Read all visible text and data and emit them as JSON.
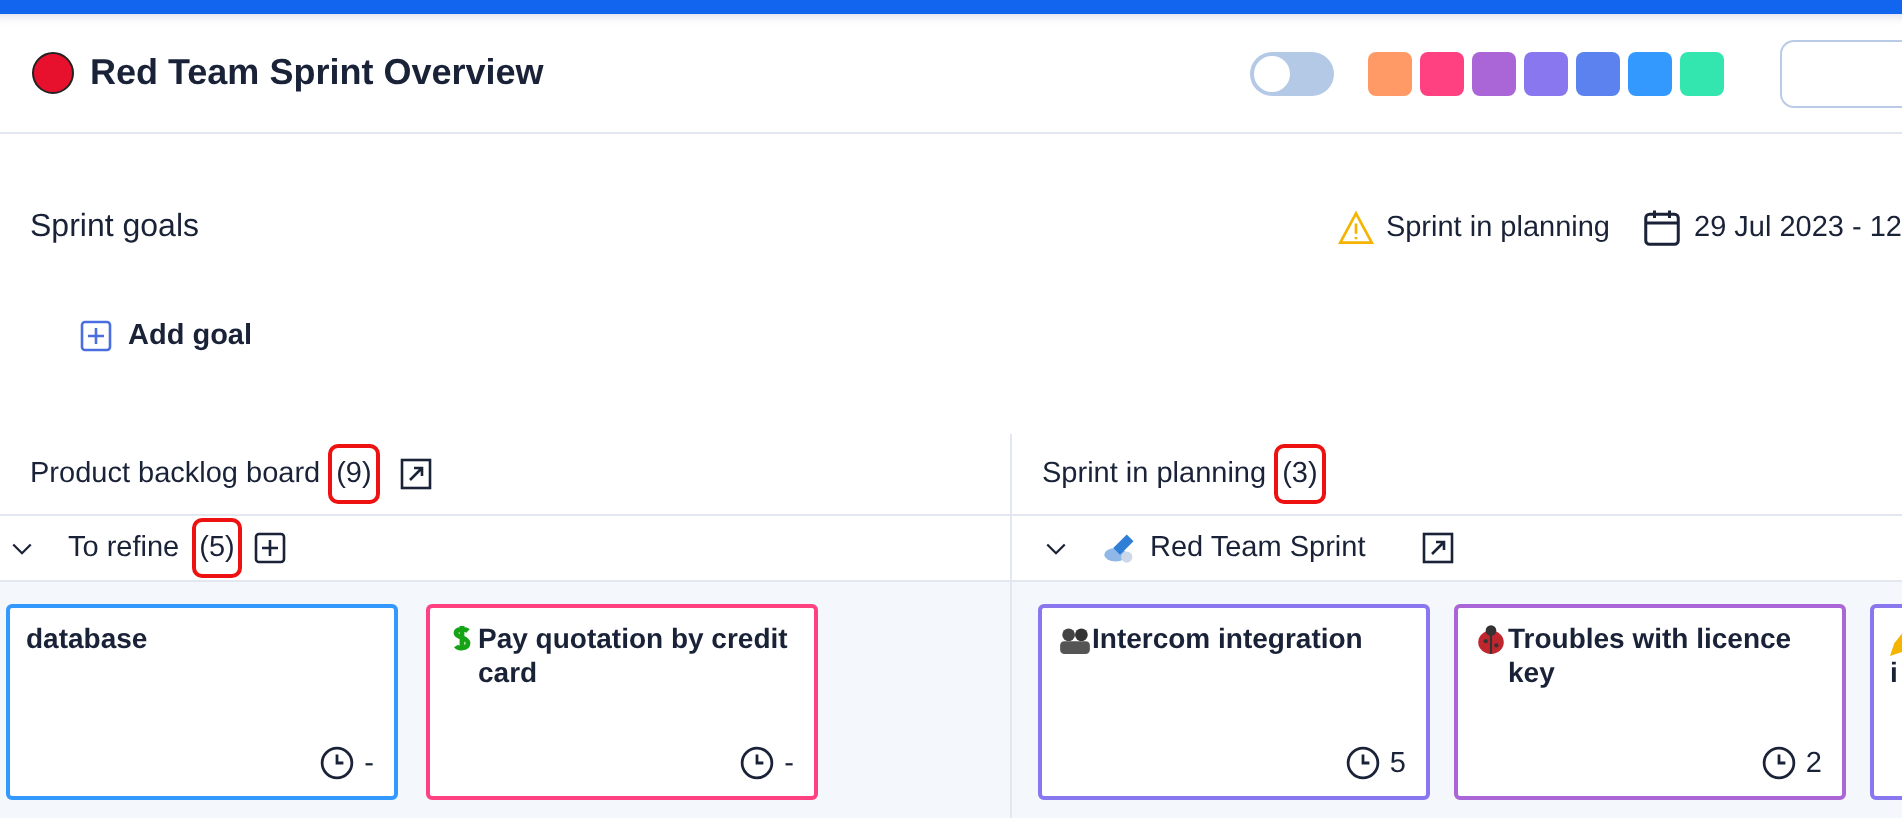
{
  "header": {
    "title": "Red Team Sprint Overview",
    "toggle": {
      "on": false
    },
    "swatches": [
      {
        "color": "#ff9966"
      },
      {
        "color": "#ff4081"
      },
      {
        "color": "#aa66d6"
      },
      {
        "color": "#8877ee"
      },
      {
        "color": "#5b82ee"
      },
      {
        "color": "#3399ff"
      },
      {
        "color": "#33e6b0"
      }
    ]
  },
  "goals": {
    "title": "Sprint goals",
    "status": "Sprint in planning",
    "dates": "29 Jul 2023 - 12",
    "add_label": "Add goal"
  },
  "columns": [
    {
      "kind": "backlog",
      "title": "Product backlog board",
      "count": "(9)",
      "count_highlighted": true,
      "group": {
        "kind": "status",
        "name": "To refine",
        "count": "(5)",
        "count_highlighted": true,
        "expanded": true
      },
      "cards": [
        {
          "kind": "plain",
          "title": "database",
          "estimate": "-",
          "color": "#3399ff"
        },
        {
          "kind": "dollar",
          "title": "Pay quotation by credit card",
          "estimate": "-",
          "color": "#ff4081"
        }
      ]
    },
    {
      "kind": "sprint",
      "title": "Sprint in planning",
      "count": "(3)",
      "count_highlighted": true,
      "group": {
        "kind": "sprint",
        "name": "Red Team Sprint",
        "expanded": true
      },
      "cards": [
        {
          "kind": "people",
          "title": "Intercom integration",
          "estimate": "5",
          "color": "#8877ee"
        },
        {
          "kind": "bug",
          "title": "Troubles with licence key",
          "estimate": "2",
          "color": "#aa66d6"
        },
        {
          "kind": "pencil",
          "title": "i",
          "color": "#8877ee"
        }
      ]
    }
  ]
}
